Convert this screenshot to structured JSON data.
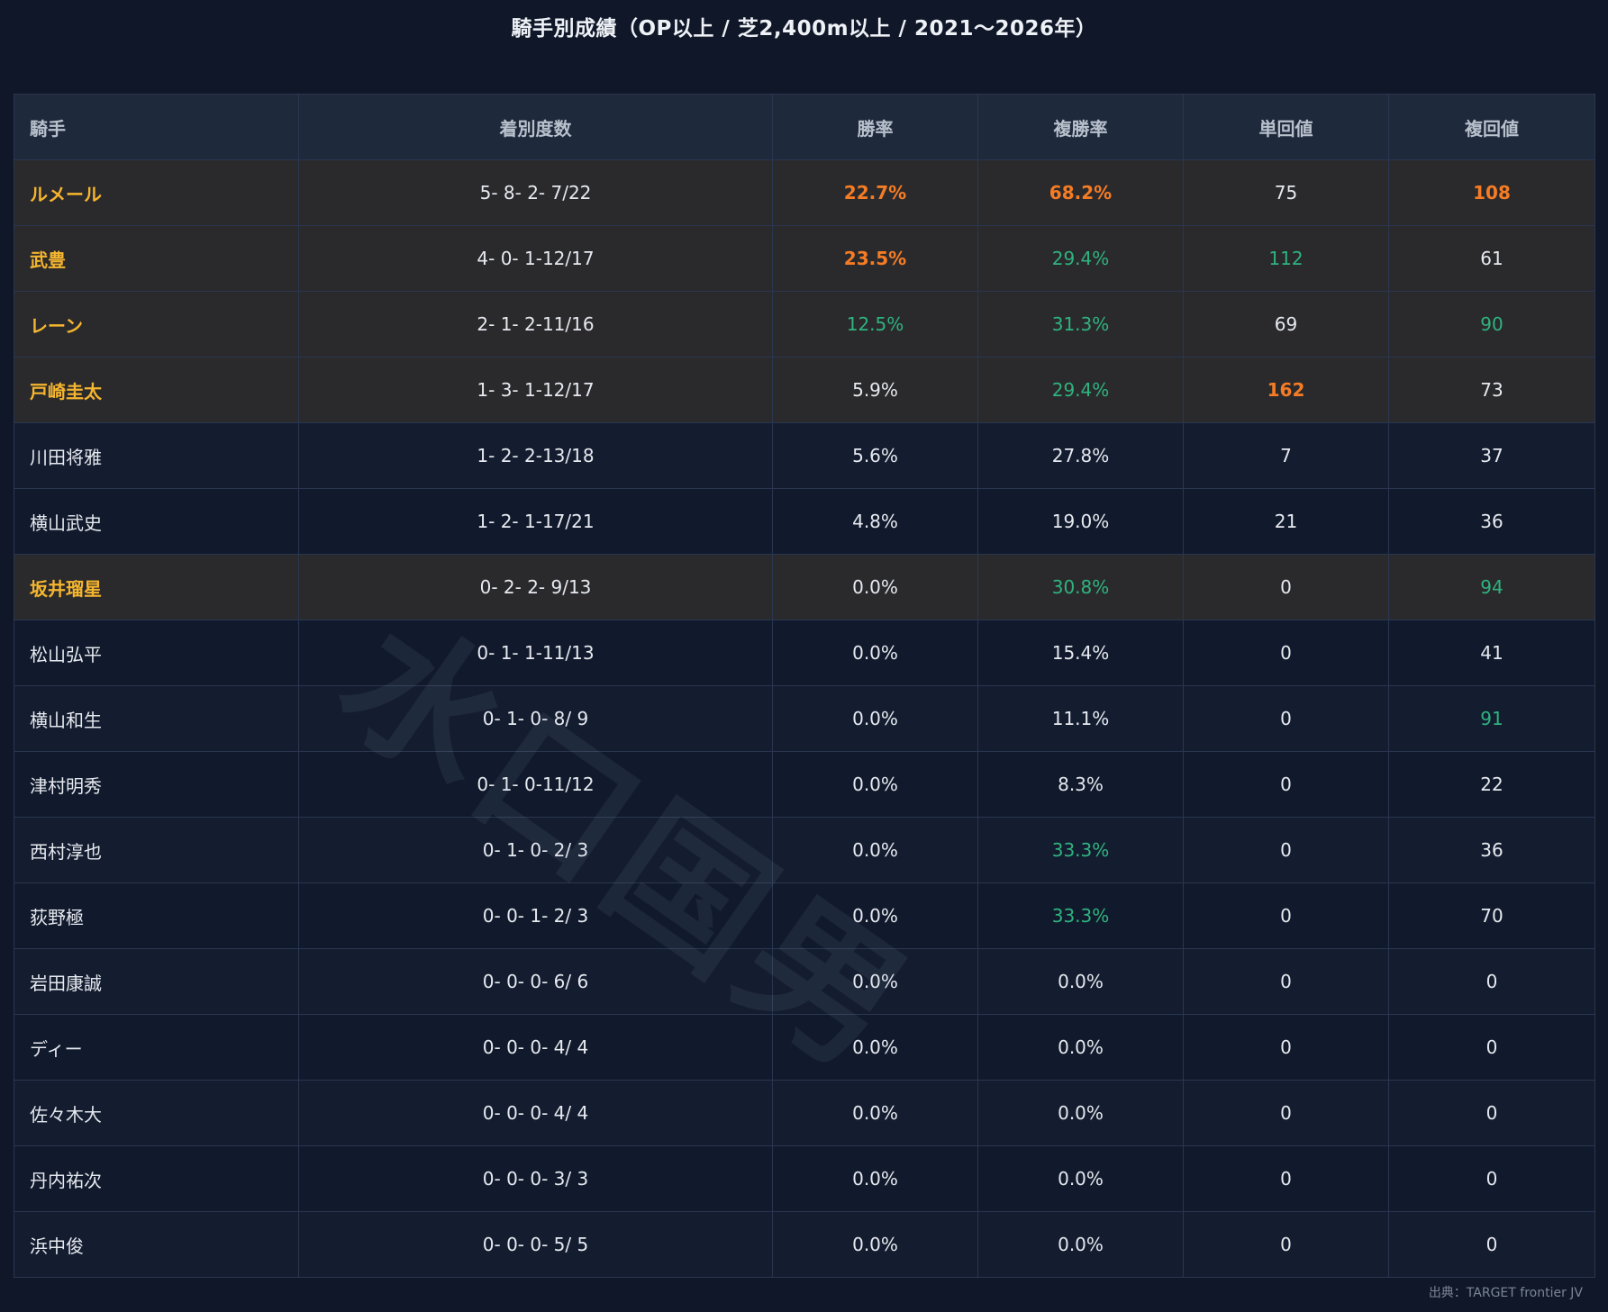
{
  "page": {
    "title": "騎手別成績（OP以上 / 芝2,400m以上 / 2021～2026年）",
    "source": "出典：TARGET frontier JV",
    "watermark": "水口国男"
  },
  "colors": {
    "background": "#0f1728",
    "header_bg": "#1e293c",
    "highlight_row_bg": "#2a2a2d",
    "highlight_name": "#f5b52e",
    "orange_value": "#f57c24",
    "green_value": "#2fb37e"
  },
  "chart_data": {
    "type": "table",
    "title": "騎手別成績（OP以上 / 芝2,400m以上 / 2021～2026年）",
    "columns": [
      "騎手",
      "着別度数",
      "勝率",
      "複勝率",
      "単回値",
      "複回値"
    ],
    "rows": [
      {
        "name": "ルメール",
        "record": "5- 8- 2- 7/22",
        "win_rate": "22.7%",
        "place_rate": "68.2%",
        "win_return": "75",
        "place_return": "108",
        "highlight": true,
        "styles": [
          "orange",
          "orange",
          "plain",
          "orange"
        ]
      },
      {
        "name": "武豊",
        "record": "4- 0- 1-12/17",
        "win_rate": "23.5%",
        "place_rate": "29.4%",
        "win_return": "112",
        "place_return": "61",
        "highlight": true,
        "styles": [
          "orange",
          "green",
          "green",
          "plain"
        ]
      },
      {
        "name": "レーン",
        "record": "2- 1- 2-11/16",
        "win_rate": "12.5%",
        "place_rate": "31.3%",
        "win_return": "69",
        "place_return": "90",
        "highlight": true,
        "styles": [
          "green",
          "green",
          "plain",
          "green"
        ]
      },
      {
        "name": "戸崎圭太",
        "record": "1- 3- 1-12/17",
        "win_rate": "5.9%",
        "place_rate": "29.4%",
        "win_return": "162",
        "place_return": "73",
        "highlight": true,
        "styles": [
          "plain",
          "green",
          "orange",
          "plain"
        ]
      },
      {
        "name": "川田将雅",
        "record": "1- 2- 2-13/18",
        "win_rate": "5.6%",
        "place_rate": "27.8%",
        "win_return": "7",
        "place_return": "37",
        "highlight": false,
        "styles": [
          "plain",
          "plain",
          "plain",
          "plain"
        ]
      },
      {
        "name": "横山武史",
        "record": "1- 2- 1-17/21",
        "win_rate": "4.8%",
        "place_rate": "19.0%",
        "win_return": "21",
        "place_return": "36",
        "highlight": false,
        "styles": [
          "plain",
          "plain",
          "plain",
          "plain"
        ]
      },
      {
        "name": "坂井瑠星",
        "record": "0- 2- 2- 9/13",
        "win_rate": "0.0%",
        "place_rate": "30.8%",
        "win_return": "0",
        "place_return": "94",
        "highlight": true,
        "styles": [
          "plain",
          "green",
          "plain",
          "green"
        ]
      },
      {
        "name": "松山弘平",
        "record": "0- 1- 1-11/13",
        "win_rate": "0.0%",
        "place_rate": "15.4%",
        "win_return": "0",
        "place_return": "41",
        "highlight": false,
        "styles": [
          "plain",
          "plain",
          "plain",
          "plain"
        ]
      },
      {
        "name": "横山和生",
        "record": "0- 1- 0- 8/ 9",
        "win_rate": "0.0%",
        "place_rate": "11.1%",
        "win_return": "0",
        "place_return": "91",
        "highlight": false,
        "styles": [
          "plain",
          "plain",
          "plain",
          "green"
        ]
      },
      {
        "name": "津村明秀",
        "record": "0- 1- 0-11/12",
        "win_rate": "0.0%",
        "place_rate": "8.3%",
        "win_return": "0",
        "place_return": "22",
        "highlight": false,
        "styles": [
          "plain",
          "plain",
          "plain",
          "plain"
        ]
      },
      {
        "name": "西村淳也",
        "record": "0- 1- 0- 2/ 3",
        "win_rate": "0.0%",
        "place_rate": "33.3%",
        "win_return": "0",
        "place_return": "36",
        "highlight": false,
        "styles": [
          "plain",
          "green",
          "plain",
          "plain"
        ]
      },
      {
        "name": "荻野極",
        "record": "0- 0- 1- 2/ 3",
        "win_rate": "0.0%",
        "place_rate": "33.3%",
        "win_return": "0",
        "place_return": "70",
        "highlight": false,
        "styles": [
          "plain",
          "green",
          "plain",
          "plain"
        ]
      },
      {
        "name": "岩田康誠",
        "record": "0- 0- 0- 6/ 6",
        "win_rate": "0.0%",
        "place_rate": "0.0%",
        "win_return": "0",
        "place_return": "0",
        "highlight": false,
        "styles": [
          "plain",
          "plain",
          "plain",
          "plain"
        ]
      },
      {
        "name": "ディー",
        "record": "0- 0- 0- 4/ 4",
        "win_rate": "0.0%",
        "place_rate": "0.0%",
        "win_return": "0",
        "place_return": "0",
        "highlight": false,
        "styles": [
          "plain",
          "plain",
          "plain",
          "plain"
        ]
      },
      {
        "name": "佐々木大",
        "record": "0- 0- 0- 4/ 4",
        "win_rate": "0.0%",
        "place_rate": "0.0%",
        "win_return": "0",
        "place_return": "0",
        "highlight": false,
        "styles": [
          "plain",
          "plain",
          "plain",
          "plain"
        ]
      },
      {
        "name": "丹内祐次",
        "record": "0- 0- 0- 3/ 3",
        "win_rate": "0.0%",
        "place_rate": "0.0%",
        "win_return": "0",
        "place_return": "0",
        "highlight": false,
        "styles": [
          "plain",
          "plain",
          "plain",
          "plain"
        ]
      },
      {
        "name": "浜中俊",
        "record": "0- 0- 0- 5/ 5",
        "win_rate": "0.0%",
        "place_rate": "0.0%",
        "win_return": "0",
        "place_return": "0",
        "highlight": false,
        "styles": [
          "plain",
          "plain",
          "plain",
          "plain"
        ]
      }
    ]
  }
}
